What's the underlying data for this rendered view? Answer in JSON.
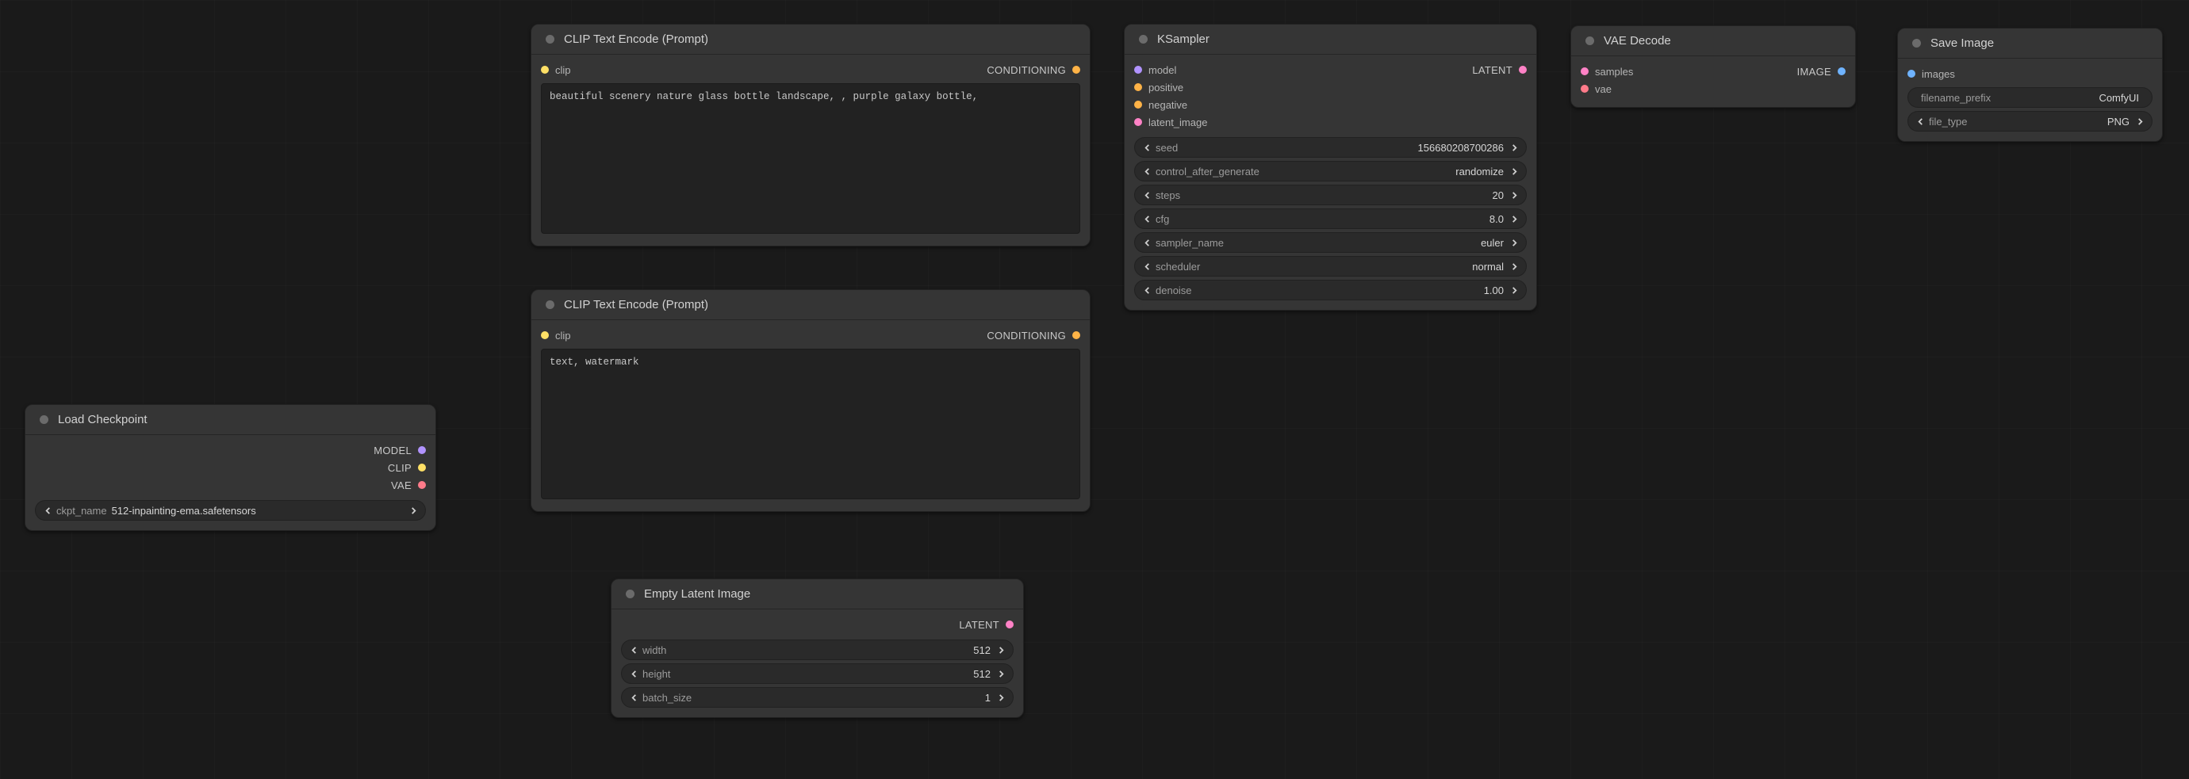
{
  "colors": {
    "model": "#b193ff",
    "clip": "#ffe066",
    "vae": "#ff7b8a",
    "conditioning": "#ffb347",
    "latent": "#ff82c6",
    "image": "#6fb3ff",
    "samples": "#ff82c6"
  },
  "nodes": {
    "load_checkpoint": {
      "title": "Load Checkpoint",
      "outputs": {
        "model": "MODEL",
        "clip": "CLIP",
        "vae": "VAE"
      },
      "widgets": {
        "ckpt_name": {
          "label": "ckpt_name",
          "value": "512-inpainting-ema.safetensors"
        }
      }
    },
    "clip_positive": {
      "title": "CLIP Text Encode (Prompt)",
      "inputs": {
        "clip": "clip"
      },
      "outputs": {
        "conditioning": "CONDITIONING"
      },
      "text": "beautiful scenery nature glass bottle landscape, , purple galaxy bottle,"
    },
    "clip_negative": {
      "title": "CLIP Text Encode (Prompt)",
      "inputs": {
        "clip": "clip"
      },
      "outputs": {
        "conditioning": "CONDITIONING"
      },
      "text": "text, watermark"
    },
    "empty_latent": {
      "title": "Empty Latent Image",
      "outputs": {
        "latent": "LATENT"
      },
      "widgets": {
        "width": {
          "label": "width",
          "value": "512"
        },
        "height": {
          "label": "height",
          "value": "512"
        },
        "batch": {
          "label": "batch_size",
          "value": "1"
        }
      }
    },
    "ksampler": {
      "title": "KSampler",
      "inputs": {
        "model": "model",
        "positive": "positive",
        "negative": "negative",
        "latent_image": "latent_image"
      },
      "outputs": {
        "latent": "LATENT"
      },
      "widgets": {
        "seed": {
          "label": "seed",
          "value": "156680208700286"
        },
        "control": {
          "label": "control_after_generate",
          "value": "randomize"
        },
        "steps": {
          "label": "steps",
          "value": "20"
        },
        "cfg": {
          "label": "cfg",
          "value": "8.0"
        },
        "sampler": {
          "label": "sampler_name",
          "value": "euler"
        },
        "scheduler": {
          "label": "scheduler",
          "value": "normal"
        },
        "denoise": {
          "label": "denoise",
          "value": "1.00"
        }
      }
    },
    "vae_decode": {
      "title": "VAE Decode",
      "inputs": {
        "samples": "samples",
        "vae": "vae"
      },
      "outputs": {
        "image": "IMAGE"
      }
    },
    "save_image": {
      "title": "Save Image",
      "inputs": {
        "images": "images"
      },
      "widgets": {
        "prefix": {
          "label": "filename_prefix",
          "value": "ComfyUI"
        },
        "filetype": {
          "label": "file_type",
          "value": "PNG"
        }
      }
    }
  }
}
